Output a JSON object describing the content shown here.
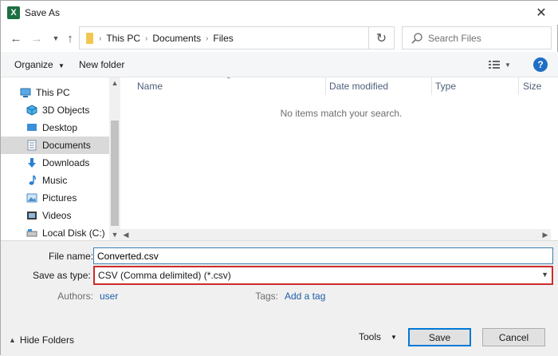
{
  "window": {
    "title": "Save As",
    "app_icon_letter": "X"
  },
  "nav": {
    "breadcrumb": [
      "This PC",
      "Documents",
      "Files"
    ],
    "search_placeholder": "Search Files"
  },
  "toolbar": {
    "organize_label": "Organize",
    "new_folder_label": "New folder"
  },
  "sidebar": {
    "items": [
      {
        "label": "This PC",
        "icon": "computer-icon",
        "indent": false,
        "selected": false
      },
      {
        "label": "3D Objects",
        "icon": "cube-icon",
        "indent": true,
        "selected": false
      },
      {
        "label": "Desktop",
        "icon": "desktop-icon",
        "indent": true,
        "selected": false
      },
      {
        "label": "Documents",
        "icon": "documents-icon",
        "indent": true,
        "selected": true
      },
      {
        "label": "Downloads",
        "icon": "download-arrow-icon",
        "indent": true,
        "selected": false
      },
      {
        "label": "Music",
        "icon": "music-note-icon",
        "indent": true,
        "selected": false
      },
      {
        "label": "Pictures",
        "icon": "pictures-icon",
        "indent": true,
        "selected": false
      },
      {
        "label": "Videos",
        "icon": "film-icon",
        "indent": true,
        "selected": false
      },
      {
        "label": "Local Disk (C:)",
        "icon": "drive-icon",
        "indent": true,
        "selected": false
      }
    ]
  },
  "content": {
    "columns": [
      "Name",
      "Date modified",
      "Type",
      "Size"
    ],
    "empty_message": "No items match your search."
  },
  "form": {
    "file_name_label": "File name:",
    "file_name_value": "Converted.csv",
    "save_as_type_label": "Save as type:",
    "save_as_type_value": "CSV (Comma delimited) (*.csv)",
    "authors_label": "Authors:",
    "authors_value": "user",
    "tags_label": "Tags:",
    "tags_value": "Add a tag"
  },
  "footer": {
    "hide_folders_label": "Hide Folders",
    "tools_label": "Tools",
    "save_label": "Save",
    "cancel_label": "Cancel"
  },
  "colors": {
    "accent": "#0078d7",
    "highlight_border": "#cc2b2b",
    "excel_green": "#1d6f42",
    "link": "#1f5ea8"
  }
}
